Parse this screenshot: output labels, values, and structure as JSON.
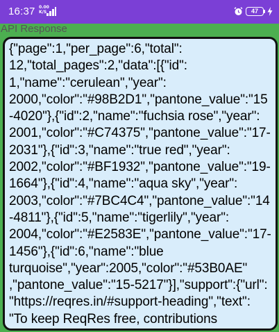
{
  "status_bar": {
    "time": "16:37",
    "net_speed": "0.00 K/S",
    "battery_level": "47",
    "icons": [
      "network-speed-icon",
      "signal-icon",
      "alarm-icon",
      "battery-icon",
      "charging-icon"
    ],
    "background_color": "#7b3fd6"
  },
  "app_bar": {
    "title": "API Response",
    "background_color": "#4caf50"
  },
  "response": {
    "background_color": "#d9edfb",
    "border_color": "#111111",
    "text": "{\"page\":1,\"per_page\":6,\"total\":\n12,\"total_pages\":2,\"data\":[{\"id\":\n1,\"name\":\"cerulean\",\"year\":\n2000,\"color\":\"#98B2D1\",\"pantone_value\":\"15\n-4020\"},{\"id\":2,\"name\":\"fuchsia rose\",\"year\":\n2001,\"color\":\"#C74375\",\"pantone_value\":\"17-\n2031\"},{\"id\":3,\"name\":\"true red\",\"year\":\n2002,\"color\":\"#BF1932\",\"pantone_value\":\"19-\n1664\"},{\"id\":4,\"name\":\"aqua sky\",\"year\":\n2003,\"color\":\"#7BC4C4\",\"pantone_value\":\"14\n-4811\"},{\"id\":5,\"name\":\"tigerlily\",\"year\":\n2004,\"color\":\"#E2583E\",\"pantone_value\":\"17-\n1456\"},{\"id\":6,\"name\":\"blue\nturquoise\",\"year\":2005,\"color\":\"#53B0AE\"\n,\"pantone_value\":\"15-5217\"}],\"support\":{\"url\":\n\"https://reqres.in/#support-heading\",\"text\":\n\"To keep ReqRes free, contributions\ntowards server costs are appreciated!\"}}"
  }
}
